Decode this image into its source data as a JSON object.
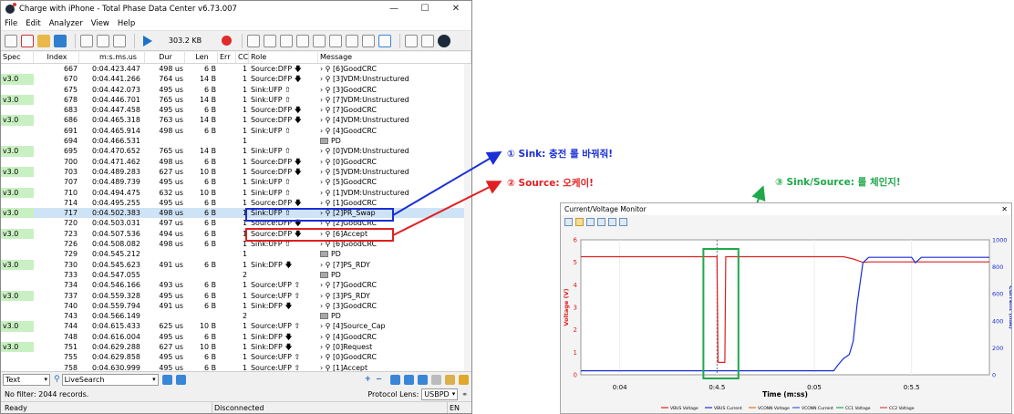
{
  "window": {
    "title": "Charge with iPhone - Total Phase Data Center v6.73.007",
    "controls": [
      "—",
      "☐",
      "✕"
    ]
  },
  "menu": [
    "File",
    "Edit",
    "Analyzer",
    "View",
    "Help"
  ],
  "toolbar": {
    "capture_size": "303.2 KB"
  },
  "columns": [
    "Spec",
    "Index",
    "m:s.ms.us",
    "Dur",
    "Len",
    "Err",
    "CC",
    "Role",
    "Message"
  ],
  "rows": [
    {
      "spec": "",
      "index": "667",
      "time": "0:04.423.447",
      "dur": "498 us",
      "len": "6 B",
      "err": "",
      "cc": "1",
      "role": "Source:DFP",
      "dir": "down",
      "msg": "[6]GoodCRC",
      "kind": "msg"
    },
    {
      "spec": "v3.0",
      "index": "670",
      "time": "0:04.441.266",
      "dur": "764 us",
      "len": "14 B",
      "err": "",
      "cc": "1",
      "role": "Source:DFP",
      "dir": "down",
      "msg": "[3]VDM:Unstructured",
      "kind": "msg"
    },
    {
      "spec": "",
      "index": "675",
      "time": "0:04.442.073",
      "dur": "495 us",
      "len": "6 B",
      "err": "",
      "cc": "1",
      "role": "Sink:UFP",
      "dir": "up",
      "msg": "[3]GoodCRC",
      "kind": "msg"
    },
    {
      "spec": "v3.0",
      "index": "678",
      "time": "0:04.446.701",
      "dur": "765 us",
      "len": "14 B",
      "err": "",
      "cc": "1",
      "role": "Sink:UFP",
      "dir": "up",
      "msg": "[7]VDM:Unstructured",
      "kind": "msg"
    },
    {
      "spec": "",
      "index": "683",
      "time": "0:04.447.458",
      "dur": "495 us",
      "len": "6 B",
      "err": "",
      "cc": "1",
      "role": "Source:DFP",
      "dir": "down",
      "msg": "[7]GoodCRC",
      "kind": "msg"
    },
    {
      "spec": "v3.0",
      "index": "686",
      "time": "0:04.465.318",
      "dur": "763 us",
      "len": "14 B",
      "err": "",
      "cc": "1",
      "role": "Source:DFP",
      "dir": "down",
      "msg": "[4]VDM:Unstructured",
      "kind": "msg"
    },
    {
      "spec": "",
      "index": "691",
      "time": "0:04.465.914",
      "dur": "498 us",
      "len": "6 B",
      "err": "",
      "cc": "1",
      "role": "Sink:UFP",
      "dir": "up",
      "msg": "[4]GoodCRC",
      "kind": "msg"
    },
    {
      "spec": "",
      "index": "694",
      "time": "0:04.466.531",
      "dur": "",
      "len": "",
      "err": "",
      "cc": "1",
      "role": "",
      "dir": "",
      "msg": "PD",
      "kind": "pd"
    },
    {
      "spec": "v3.0",
      "index": "695",
      "time": "0:04.470.652",
      "dur": "765 us",
      "len": "14 B",
      "err": "",
      "cc": "1",
      "role": "Sink:UFP",
      "dir": "up",
      "msg": "[0]VDM:Unstructured",
      "kind": "msg"
    },
    {
      "spec": "",
      "index": "700",
      "time": "0:04.471.462",
      "dur": "498 us",
      "len": "6 B",
      "err": "",
      "cc": "1",
      "role": "Source:DFP",
      "dir": "down",
      "msg": "[0]GoodCRC",
      "kind": "msg"
    },
    {
      "spec": "v3.0",
      "index": "703",
      "time": "0:04.489.283",
      "dur": "627 us",
      "len": "10 B",
      "err": "",
      "cc": "1",
      "role": "Source:DFP",
      "dir": "down",
      "msg": "[5]VDM:Unstructured",
      "kind": "msg"
    },
    {
      "spec": "",
      "index": "707",
      "time": "0:04.489.739",
      "dur": "495 us",
      "len": "6 B",
      "err": "",
      "cc": "1",
      "role": "Sink:UFP",
      "dir": "up",
      "msg": "[5]GoodCRC",
      "kind": "msg"
    },
    {
      "spec": "v3.0",
      "index": "710",
      "time": "0:04.494.475",
      "dur": "632 us",
      "len": "10 B",
      "err": "",
      "cc": "1",
      "role": "Sink:UFP",
      "dir": "up",
      "msg": "[1]VDM:Unstructured",
      "kind": "msg"
    },
    {
      "spec": "",
      "index": "714",
      "time": "0:04.495.255",
      "dur": "495 us",
      "len": "6 B",
      "err": "",
      "cc": "1",
      "role": "Source:DFP",
      "dir": "down",
      "msg": "[1]GoodCRC",
      "kind": "msg"
    },
    {
      "spec": "v3.0",
      "index": "717",
      "time": "0:04.502.383",
      "dur": "498 us",
      "len": "6 B",
      "err": "",
      "cc": "1",
      "role": "Sink:UFP",
      "dir": "up",
      "msg": "[2]PR_Swap",
      "kind": "msg",
      "selected": true
    },
    {
      "spec": "",
      "index": "720",
      "time": "0:04.503.031",
      "dur": "497 us",
      "len": "6 B",
      "err": "",
      "cc": "1",
      "role": "Source:DFP",
      "dir": "down",
      "msg": "[2]GoodCRC",
      "kind": "msg"
    },
    {
      "spec": "v3.0",
      "index": "723",
      "time": "0:04.507.536",
      "dur": "494 us",
      "len": "6 B",
      "err": "",
      "cc": "1",
      "role": "Source:DFP",
      "dir": "down",
      "msg": "[6]Accept",
      "kind": "msg"
    },
    {
      "spec": "",
      "index": "726",
      "time": "0:04.508.082",
      "dur": "498 us",
      "len": "6 B",
      "err": "",
      "cc": "1",
      "role": "Sink:UFP",
      "dir": "up",
      "msg": "[6]GoodCRC",
      "kind": "msg"
    },
    {
      "spec": "",
      "index": "729",
      "time": "0:04.545.212",
      "dur": "",
      "len": "",
      "err": "",
      "cc": "1",
      "role": "",
      "dir": "",
      "msg": "PD",
      "kind": "pd"
    },
    {
      "spec": "v3.0",
      "index": "730",
      "time": "0:04.545.623",
      "dur": "491 us",
      "len": "6 B",
      "err": "",
      "cc": "1",
      "role": "Sink:DFP",
      "dir": "down",
      "msg": "[7]PS_RDY",
      "kind": "msg"
    },
    {
      "spec": "",
      "index": "733",
      "time": "0:04.547.055",
      "dur": "",
      "len": "",
      "err": "",
      "cc": "2",
      "role": "",
      "dir": "",
      "msg": "PD",
      "kind": "pd"
    },
    {
      "spec": "",
      "index": "734",
      "time": "0:04.546.166",
      "dur": "493 us",
      "len": "6 B",
      "err": "",
      "cc": "1",
      "role": "Source:UFP",
      "dir": "up",
      "msg": "[7]GoodCRC",
      "kind": "msg"
    },
    {
      "spec": "v3.0",
      "index": "737",
      "time": "0:04.559.328",
      "dur": "495 us",
      "len": "6 B",
      "err": "",
      "cc": "1",
      "role": "Source:UFP",
      "dir": "up",
      "msg": "[3]PS_RDY",
      "kind": "msg"
    },
    {
      "spec": "",
      "index": "740",
      "time": "0:04.559.794",
      "dur": "491 us",
      "len": "6 B",
      "err": "",
      "cc": "1",
      "role": "Sink:DFP",
      "dir": "down",
      "msg": "[3]GoodCRC",
      "kind": "msg"
    },
    {
      "spec": "",
      "index": "743",
      "time": "0:04.566.149",
      "dur": "",
      "len": "",
      "err": "",
      "cc": "2",
      "role": "",
      "dir": "",
      "msg": "PD",
      "kind": "pd"
    },
    {
      "spec": "v3.0",
      "index": "744",
      "time": "0:04.615.433",
      "dur": "625 us",
      "len": "10 B",
      "err": "",
      "cc": "1",
      "role": "Source:UFP",
      "dir": "up",
      "msg": "[4]Source_Cap",
      "kind": "msg"
    },
    {
      "spec": "",
      "index": "748",
      "time": "0:04.616.004",
      "dur": "495 us",
      "len": "6 B",
      "err": "",
      "cc": "1",
      "role": "Sink:DFP",
      "dir": "down",
      "msg": "[4]GoodCRC",
      "kind": "msg"
    },
    {
      "spec": "v3.0",
      "index": "751",
      "time": "0:04.629.288",
      "dur": "627 us",
      "len": "10 B",
      "err": "",
      "cc": "1",
      "role": "Sink:DFP",
      "dir": "down",
      "msg": "[0]Request",
      "kind": "msg"
    },
    {
      "spec": "",
      "index": "755",
      "time": "0:04.629.858",
      "dur": "495 us",
      "len": "6 B",
      "err": "",
      "cc": "1",
      "role": "Source:UFP",
      "dir": "up",
      "msg": "[0]GoodCRC",
      "kind": "msg"
    },
    {
      "spec": "",
      "index": "758",
      "time": "0:04.630.999",
      "dur": "495 us",
      "len": "6 B",
      "err": "",
      "cc": "1",
      "role": "Source:UFP",
      "dir": "up",
      "msg": "[1]Accept",
      "kind": "msg"
    }
  ],
  "filterbar": {
    "mode": "Text",
    "search": "LiveSearch"
  },
  "statusline": {
    "filter": "No filter: 2044 records.",
    "protocol_label": "Protocol Lens:",
    "protocol_value": "USBPD"
  },
  "statusbar": {
    "ready": "Ready",
    "conn": "Disconnected",
    "lang": "EN"
  },
  "annotations": {
    "a1": "① Sink: 충전 롤 바꿔줘!",
    "a2": "② Source: 오케이!",
    "a3": "③ Sink/Source: 롤 체인지!"
  },
  "monitor": {
    "title": "Current/Voltage Monitor",
    "close": "✕"
  },
  "colors": {
    "red": "#e02020",
    "blue": "#1a2fd6",
    "green": "#1fa84a"
  },
  "chart_data": {
    "type": "line",
    "xlabel": "Time (m:ss)",
    "ylabel_left": "Voltage (V)",
    "ylabel_right": "Current (mA)",
    "x_ticks": [
      "0:04",
      "0:4.5",
      "0:05",
      "0:5.5"
    ],
    "ylim_left": [
      0,
      6
    ],
    "ylim_right": [
      0,
      1000
    ],
    "y_ticks_left": [
      "0",
      "1",
      "2",
      "3",
      "4",
      "5",
      "6"
    ],
    "y_ticks_right": [
      "0",
      "200",
      "400",
      "600",
      "800",
      "1000"
    ],
    "legend": [
      "VBUS Voltage",
      "VBUS Current",
      "VCONN Voltage",
      "VCONN Current",
      "CC1 Voltage",
      "CC2 Voltage"
    ],
    "series": [
      {
        "name": "VBUS Voltage",
        "axis": "left",
        "points": [
          [
            3.8,
            5.25
          ],
          [
            4.49,
            5.25
          ],
          [
            4.5,
            5.25
          ],
          [
            4.505,
            0.55
          ],
          [
            4.54,
            0.55
          ],
          [
            4.545,
            5.25
          ],
          [
            4.6,
            5.25
          ],
          [
            5.15,
            5.25
          ],
          [
            5.2,
            5.15
          ],
          [
            5.25,
            5.0
          ],
          [
            5.28,
            5.02
          ],
          [
            5.9,
            5.02
          ]
        ]
      },
      {
        "name": "VBUS Current",
        "axis": "right",
        "points": [
          [
            3.8,
            30
          ],
          [
            5.1,
            30
          ],
          [
            5.12,
            70
          ],
          [
            5.15,
            120
          ],
          [
            5.18,
            150
          ],
          [
            5.2,
            250
          ],
          [
            5.22,
            520
          ],
          [
            5.25,
            830
          ],
          [
            5.28,
            870
          ],
          [
            5.5,
            870
          ],
          [
            5.52,
            830
          ],
          [
            5.55,
            870
          ],
          [
            5.9,
            870
          ]
        ]
      }
    ],
    "xlim": [
      3.8,
      5.9
    ]
  }
}
